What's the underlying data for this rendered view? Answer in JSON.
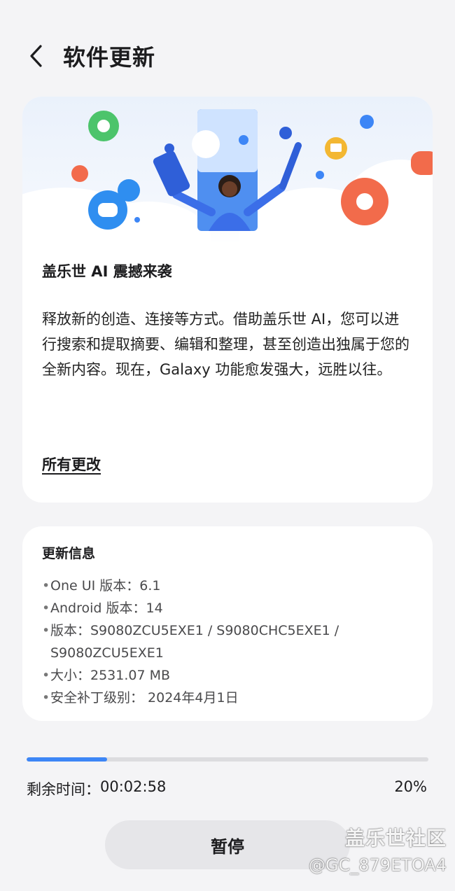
{
  "header": {
    "title": "软件更新",
    "back_icon": "chevron-left-icon"
  },
  "hero_card": {
    "title": "盖乐世 AI 震撼来袭",
    "description": "释放新的创造、连接等方式。借助盖乐世 AI，您可以进行搜索和提取摘要、编辑和整理，甚至创造出独属于您的全新内容。现在，Galaxy 功能愈发强大，远胜以往。",
    "link_label": "所有更改"
  },
  "info_card": {
    "title": "更新信息",
    "items": [
      "One UI 版本：6.1",
      "Android 版本：14",
      "版本：S9080ZCU5EXE1 / S9080CHC5EXE1 / S9080ZCU5EXE1",
      "大小：2531.07 MB",
      "安全补丁级别： 2024年4月1日"
    ]
  },
  "progress": {
    "fraction": 0.2,
    "remaining_label": "剩余时间：",
    "remaining_value": "00:02:58",
    "percent_label": "20%"
  },
  "actions": {
    "pause_label": "暂停"
  },
  "watermark": {
    "brand": "盖乐世社区",
    "user": "@GC_879ETOA4"
  },
  "colors": {
    "accent": "#3d86f6",
    "background": "#f4f4f6",
    "card": "#ffffff"
  }
}
